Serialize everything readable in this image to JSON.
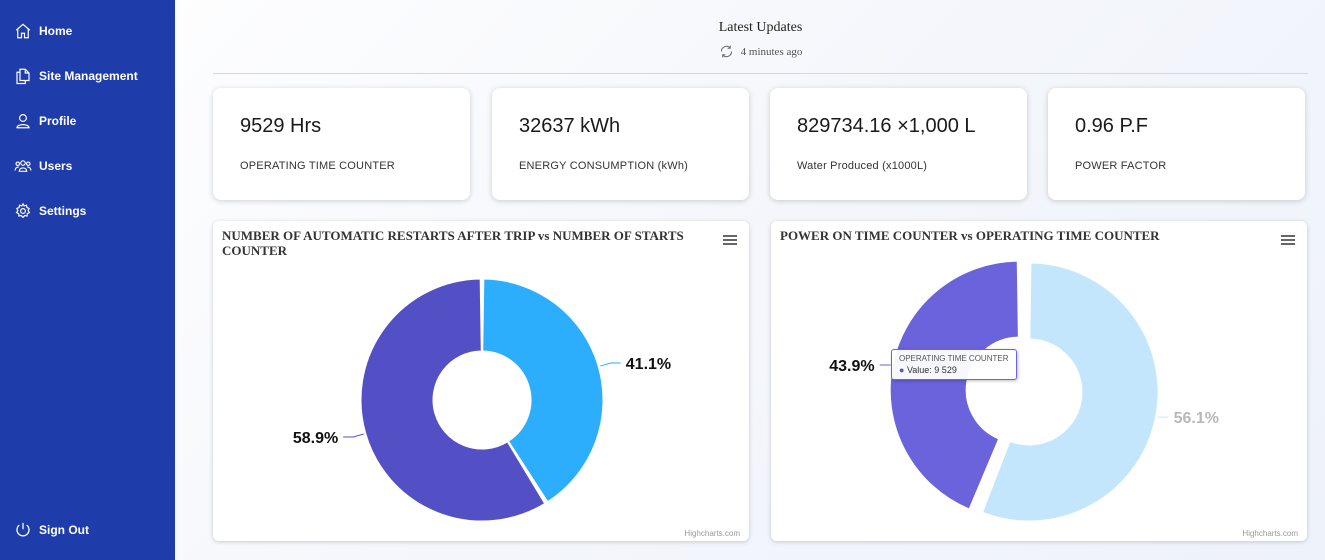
{
  "sidebar": {
    "items": [
      {
        "label": "Home",
        "icon": "home-icon"
      },
      {
        "label": "Site Management",
        "icon": "documents-icon"
      },
      {
        "label": "Profile",
        "icon": "user-icon"
      },
      {
        "label": "Users",
        "icon": "users-icon"
      },
      {
        "label": "Settings",
        "icon": "gear-icon"
      }
    ],
    "sign_out": {
      "label": "Sign Out",
      "icon": "power-icon"
    },
    "bg_color": "#1f3daa"
  },
  "header": {
    "title": "Latest Updates",
    "updated": "4 minutes ago",
    "refresh_icon": "refresh-icon"
  },
  "stats": [
    {
      "value": "9529 Hrs",
      "label": "OPERATING TIME COUNTER"
    },
    {
      "value": "32637 kWh",
      "label": "ENERGY CONSUMPTION (kWh)"
    },
    {
      "value": "829734.16 ×1,000 L",
      "label": "Water Produced (x1000L)"
    },
    {
      "value": "0.96 P.F",
      "label": "POWER FACTOR"
    }
  ],
  "charts": [
    {
      "title": "NUMBER OF AUTOMATIC RESTARTS AFTER TRIP vs NUMBER OF STARTS COUNTER",
      "credit": "Highcharts.com",
      "menu_icon": "hamburger-icon"
    },
    {
      "title": "POWER ON TIME COUNTER vs OPERATING TIME COUNTER",
      "credit": "Highcharts.com",
      "menu_icon": "hamburger-icon",
      "tooltip": {
        "title": "OPERATING TIME COUNTER",
        "line": "Value: 9 529"
      }
    }
  ],
  "chart_data": [
    {
      "type": "pie",
      "title": "NUMBER OF AUTOMATIC RESTARTS AFTER TRIP vs NUMBER OF STARTS COUNTER",
      "donut": true,
      "slices": [
        {
          "value": 41.1,
          "label": "41.1%",
          "color": "#2daefd"
        },
        {
          "value": 58.9,
          "label": "58.9%",
          "color": "#5350c6"
        }
      ]
    },
    {
      "type": "pie",
      "title": "POWER ON TIME COUNTER vs OPERATING TIME COUNTER",
      "donut": true,
      "slices": [
        {
          "value": 56.1,
          "label": "56.1%",
          "color": "#c3e6fd",
          "label_color": "#b8b8b8"
        },
        {
          "value": 43.9,
          "label": "43.9%",
          "color": "#6a63dc",
          "label_color": "#111111",
          "name": "OPERATING TIME COUNTER",
          "raw_value": 9529
        }
      ]
    }
  ]
}
